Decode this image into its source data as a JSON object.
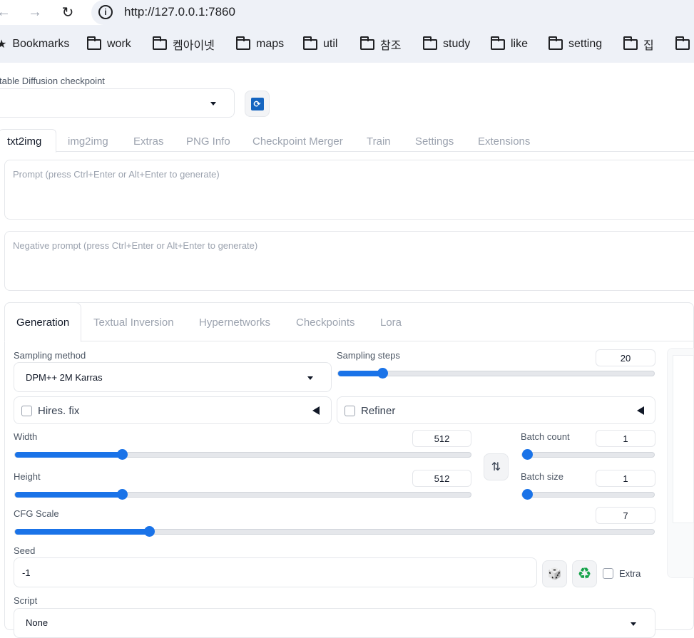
{
  "browser": {
    "nav": {
      "back_icon": "←",
      "forward_icon": "→",
      "reload_icon": "↻"
    },
    "address": "http://127.0.0.1:7860",
    "bookmarks": [
      {
        "label": "Bookmarks",
        "icon": "star-icon"
      },
      {
        "label": "work",
        "icon": "folder-icon"
      },
      {
        "label": "켐아이넷",
        "icon": "folder-icon"
      },
      {
        "label": "maps",
        "icon": "folder-icon"
      },
      {
        "label": "util",
        "icon": "folder-icon"
      },
      {
        "label": "참조",
        "icon": "folder-icon"
      },
      {
        "label": "study",
        "icon": "folder-icon"
      },
      {
        "label": "like",
        "icon": "folder-icon"
      },
      {
        "label": "setting",
        "icon": "folder-icon"
      },
      {
        "label": "집",
        "icon": "folder-icon"
      },
      {
        "label": "",
        "icon": "folder-icon"
      }
    ]
  },
  "checkpoint": {
    "label": "table Diffusion checkpoint",
    "value": ""
  },
  "main_tabs": [
    "txt2img",
    "img2img",
    "Extras",
    "PNG Info",
    "Checkpoint Merger",
    "Train",
    "Settings",
    "Extensions"
  ],
  "prompt": {
    "placeholder": "Prompt (press Ctrl+Enter or Alt+Enter to generate)"
  },
  "negative_prompt": {
    "placeholder": "Negative prompt (press Ctrl+Enter or Alt+Enter to generate)"
  },
  "gen_tabs": [
    "Generation",
    "Textual Inversion",
    "Hypernetworks",
    "Checkpoints",
    "Lora"
  ],
  "sampling_method": {
    "label": "Sampling method",
    "value": "DPM++ 2M Karras"
  },
  "sampling_steps": {
    "label": "Sampling steps",
    "value": "20",
    "fraction": 0.14
  },
  "hires_fix": {
    "label": "Hires. fix"
  },
  "refiner": {
    "label": "Refiner"
  },
  "width": {
    "label": "Width",
    "value": "512",
    "fraction": 0.235
  },
  "height": {
    "label": "Height",
    "value": "512",
    "fraction": 0.235
  },
  "batch_count": {
    "label": "Batch count",
    "value": "1",
    "fraction": 0
  },
  "batch_size": {
    "label": "Batch size",
    "value": "1",
    "fraction": 0
  },
  "cfg_scale": {
    "label": "CFG Scale",
    "value": "7",
    "fraction": 0.21
  },
  "seed": {
    "label": "Seed",
    "value": "-1"
  },
  "extra": {
    "label": "Extra"
  },
  "script": {
    "label": "Script",
    "value": "None"
  },
  "icons": {
    "swap": "⇅",
    "dice": "🎲",
    "recycle": "♻"
  },
  "colors": {
    "accent": "#1a73e8",
    "refresh_button": "#1565c0"
  }
}
